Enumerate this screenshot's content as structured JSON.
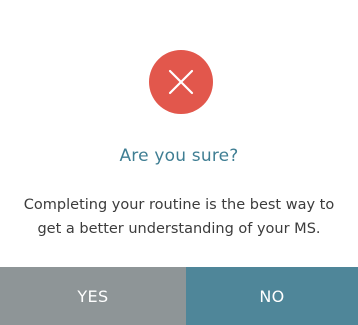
{
  "dialog": {
    "icon": "close-x-icon",
    "title": "Are you sure?",
    "message": "Completing your routine is the best way to get a better understanding of your MS.",
    "yes_label": "YES",
    "no_label": "NO"
  },
  "colors": {
    "icon_circle": "#e2574c",
    "title": "#3f7e93",
    "yes_button": "#8e9597",
    "no_button": "#4f8699"
  }
}
